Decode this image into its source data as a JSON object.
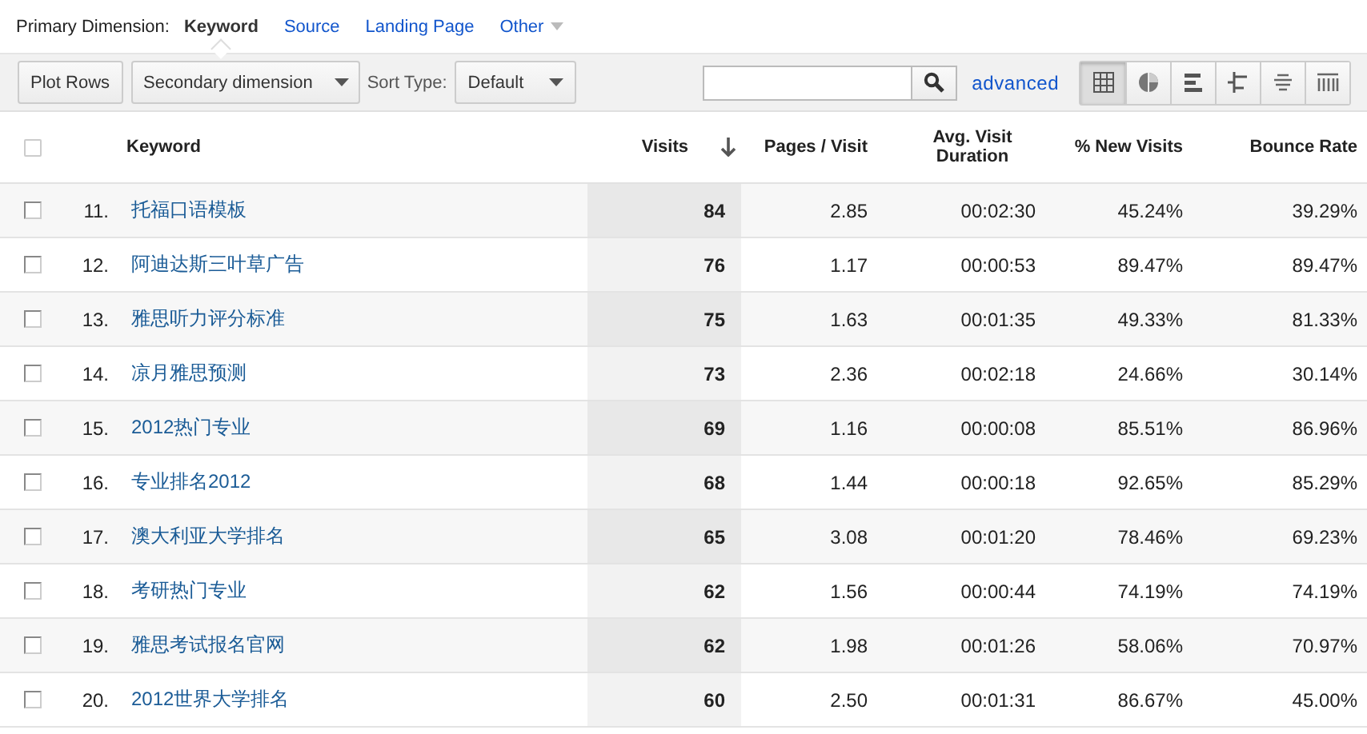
{
  "primary_dimension": {
    "label": "Primary Dimension:",
    "options": [
      {
        "label": "Keyword",
        "selected": true,
        "dropdown": false
      },
      {
        "label": "Source",
        "selected": false,
        "dropdown": false
      },
      {
        "label": "Landing Page",
        "selected": false,
        "dropdown": false
      },
      {
        "label": "Other",
        "selected": false,
        "dropdown": true
      }
    ]
  },
  "toolbar": {
    "plot_button": "Plot Rows",
    "secondary_dimension": "Secondary dimension",
    "sort_label": "Sort Type:",
    "sort_value": "Default",
    "advanced_link": "advanced",
    "views": [
      {
        "kind": "table",
        "selected": true
      },
      {
        "kind": "pie",
        "selected": false
      },
      {
        "kind": "bars",
        "selected": false
      },
      {
        "kind": "compare",
        "selected": false
      },
      {
        "kind": "terms",
        "selected": false
      },
      {
        "kind": "pivot",
        "selected": false
      }
    ]
  },
  "table": {
    "select_all": {
      "checked": false
    },
    "columns": [
      {
        "label": "Keyword",
        "sorted": false
      },
      {
        "label": "Visits",
        "sorted": true
      },
      {
        "label": "Pages / Visit",
        "sorted": false
      },
      {
        "label": "Avg. Visit Duration",
        "sorted": false
      },
      {
        "label": "% New Visits",
        "sorted": false
      },
      {
        "label": "Bounce Rate",
        "sorted": false
      }
    ],
    "rows": [
      {
        "checked": false,
        "index": "11.",
        "cells": [
          "托福口语模板",
          "84",
          "2.85",
          "00:02:30",
          "45.24%",
          "39.29%"
        ]
      },
      {
        "checked": false,
        "index": "12.",
        "cells": [
          "阿迪达斯三叶草广告",
          "76",
          "1.17",
          "00:00:53",
          "89.47%",
          "89.47%"
        ]
      },
      {
        "checked": false,
        "index": "13.",
        "cells": [
          "雅思听力评分标准",
          "75",
          "1.63",
          "00:01:35",
          "49.33%",
          "81.33%"
        ]
      },
      {
        "checked": false,
        "index": "14.",
        "cells": [
          "凉月雅思预测",
          "73",
          "2.36",
          "00:02:18",
          "24.66%",
          "30.14%"
        ]
      },
      {
        "checked": false,
        "index": "15.",
        "cells": [
          "2012热门专业",
          "69",
          "1.16",
          "00:00:08",
          "85.51%",
          "86.96%"
        ]
      },
      {
        "checked": false,
        "index": "16.",
        "cells": [
          "专业排名2012",
          "68",
          "1.44",
          "00:00:18",
          "92.65%",
          "85.29%"
        ]
      },
      {
        "checked": false,
        "index": "17.",
        "cells": [
          "澳大利亚大学排名",
          "65",
          "3.08",
          "00:01:20",
          "78.46%",
          "69.23%"
        ]
      },
      {
        "checked": false,
        "index": "18.",
        "cells": [
          "考研热门专业",
          "62",
          "1.56",
          "00:00:44",
          "74.19%",
          "74.19%"
        ]
      },
      {
        "checked": false,
        "index": "19.",
        "cells": [
          "雅思考试报名官网",
          "62",
          "1.98",
          "00:01:26",
          "58.06%",
          "70.97%"
        ]
      },
      {
        "checked": false,
        "index": "20.",
        "cells": [
          "2012世界大学排名",
          "60",
          "2.50",
          "00:01:31",
          "86.67%",
          "45.00%"
        ]
      }
    ]
  }
}
